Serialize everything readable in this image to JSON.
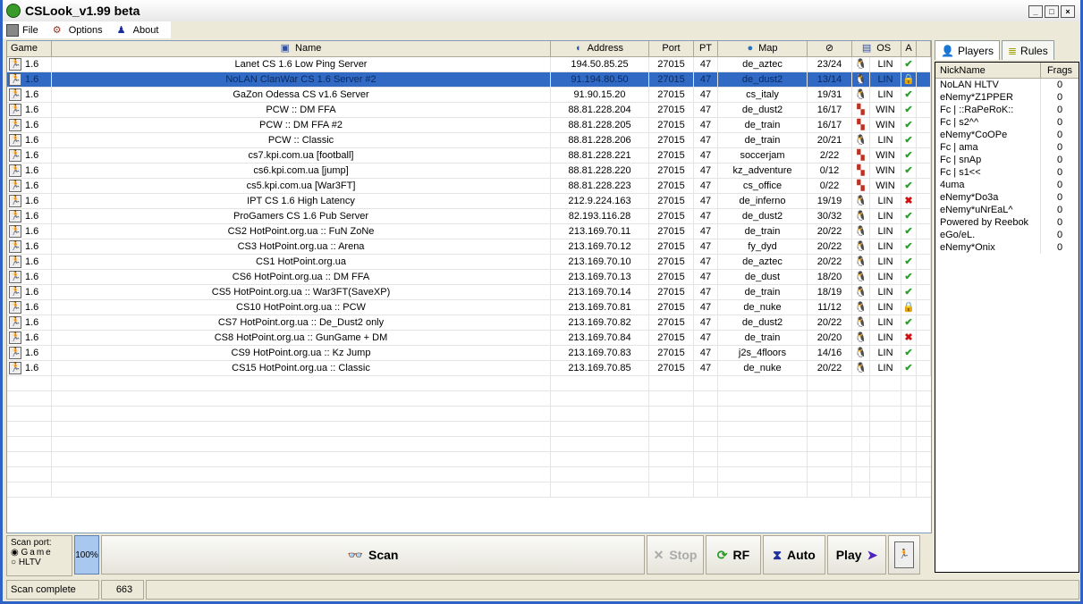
{
  "window": {
    "title": "CSLook_v1.99 beta"
  },
  "menu": {
    "file": "File",
    "options": "Options",
    "about": "About"
  },
  "columns": {
    "game": "Game",
    "name": "Name",
    "address": "Address",
    "port": "Port",
    "pt": "PT",
    "map": "Map",
    "os": "OS",
    "a": "A"
  },
  "servers": [
    {
      "game": "1.6",
      "name": "Lanet CS 1.6 Low Ping Server",
      "address": "194.50.85.25",
      "port": "27015",
      "pt": "47",
      "map": "de_aztec",
      "players": "23/24",
      "os": "LIN",
      "status": "ok"
    },
    {
      "game": "1.6",
      "name": "NoLAN ClanWar CS 1.6 Server #2",
      "address": "91.194.80.50",
      "port": "27015",
      "pt": "47",
      "map": "de_dust2",
      "players": "13/14",
      "os": "LIN",
      "status": "locked",
      "selected": true
    },
    {
      "game": "1.6",
      "name": "GaZon Odessa CS v1.6 Server",
      "address": "91.90.15.20",
      "port": "27015",
      "pt": "47",
      "map": "cs_italy",
      "players": "19/31",
      "os": "LIN",
      "status": "ok"
    },
    {
      "game": "1.6",
      "name": "PCW :: DM FFA",
      "address": "88.81.228.204",
      "port": "27015",
      "pt": "47",
      "map": "de_dust2",
      "players": "16/17",
      "os": "WIN",
      "status": "ok"
    },
    {
      "game": "1.6",
      "name": "PCW :: DM FFA #2",
      "address": "88.81.228.205",
      "port": "27015",
      "pt": "47",
      "map": "de_train",
      "players": "16/17",
      "os": "WIN",
      "status": "ok"
    },
    {
      "game": "1.6",
      "name": "PCW :: Classic",
      "address": "88.81.228.206",
      "port": "27015",
      "pt": "47",
      "map": "de_train",
      "players": "20/21",
      "os": "LIN",
      "status": "ok"
    },
    {
      "game": "1.6",
      "name": "cs7.kpi.com.ua [football]",
      "address": "88.81.228.221",
      "port": "27015",
      "pt": "47",
      "map": "soccerjam",
      "players": "2/22",
      "os": "WIN",
      "status": "ok"
    },
    {
      "game": "1.6",
      "name": "cs6.kpi.com.ua [jump]",
      "address": "88.81.228.220",
      "port": "27015",
      "pt": "47",
      "map": "kz_adventure",
      "players": "0/12",
      "os": "WIN",
      "status": "ok"
    },
    {
      "game": "1.6",
      "name": "cs5.kpi.com.ua [War3FT]",
      "address": "88.81.228.223",
      "port": "27015",
      "pt": "47",
      "map": "cs_office",
      "players": "0/22",
      "os": "WIN",
      "status": "ok"
    },
    {
      "game": "1.6",
      "name": "IPT CS 1.6 High Latency",
      "address": "212.9.224.163",
      "port": "27015",
      "pt": "47",
      "map": "de_inferno",
      "players": "19/19",
      "os": "LIN",
      "status": "down"
    },
    {
      "game": "1.6",
      "name": "ProGamers CS 1.6 Pub Server",
      "address": "82.193.116.28",
      "port": "27015",
      "pt": "47",
      "map": "de_dust2",
      "players": "30/32",
      "os": "LIN",
      "status": "ok"
    },
    {
      "game": "1.6",
      "name": "CS2 HotPoint.org.ua :: FuN ZoNe",
      "address": "213.169.70.11",
      "port": "27015",
      "pt": "47",
      "map": "de_train",
      "players": "20/22",
      "os": "LIN",
      "status": "ok"
    },
    {
      "game": "1.6",
      "name": "CS3 HotPoint.org.ua :: Arena",
      "address": "213.169.70.12",
      "port": "27015",
      "pt": "47",
      "map": "fy_dyd",
      "players": "20/22",
      "os": "LIN",
      "status": "ok"
    },
    {
      "game": "1.6",
      "name": "CS1 HotPoint.org.ua",
      "address": "213.169.70.10",
      "port": "27015",
      "pt": "47",
      "map": "de_aztec",
      "players": "20/22",
      "os": "LIN",
      "status": "ok"
    },
    {
      "game": "1.6",
      "name": "CS6 HotPoint.org.ua :: DM FFA",
      "address": "213.169.70.13",
      "port": "27015",
      "pt": "47",
      "map": "de_dust",
      "players": "18/20",
      "os": "LIN",
      "status": "ok"
    },
    {
      "game": "1.6",
      "name": "CS5 HotPoint.org.ua :: War3FT(SaveXP)",
      "address": "213.169.70.14",
      "port": "27015",
      "pt": "47",
      "map": "de_train",
      "players": "18/19",
      "os": "LIN",
      "status": "ok"
    },
    {
      "game": "1.6",
      "name": "CS10 HotPoint.org.ua :: PCW",
      "address": "213.169.70.81",
      "port": "27015",
      "pt": "47",
      "map": "de_nuke",
      "players": "11/12",
      "os": "LIN",
      "status": "locked"
    },
    {
      "game": "1.6",
      "name": "CS7 HotPoint.org.ua :: De_Dust2 only",
      "address": "213.169.70.82",
      "port": "27015",
      "pt": "47",
      "map": "de_dust2",
      "players": "20/22",
      "os": "LIN",
      "status": "ok"
    },
    {
      "game": "1.6",
      "name": "CS8 HotPoint.org.ua :: GunGame + DM",
      "address": "213.169.70.84",
      "port": "27015",
      "pt": "47",
      "map": "de_train",
      "players": "20/20",
      "os": "LIN",
      "status": "down"
    },
    {
      "game": "1.6",
      "name": "CS9 HotPoint.org.ua :: Kz Jump",
      "address": "213.169.70.83",
      "port": "27015",
      "pt": "47",
      "map": "j2s_4floors",
      "players": "14/16",
      "os": "LIN",
      "status": "ok"
    },
    {
      "game": "1.6",
      "name": "CS15 HotPoint.org.ua :: Classic",
      "address": "213.169.70.85",
      "port": "27015",
      "pt": "47",
      "map": "de_nuke",
      "players": "20/22",
      "os": "LIN",
      "status": "ok"
    }
  ],
  "side": {
    "tab_players": "Players",
    "tab_rules": "Rules",
    "col_nick": "NickName",
    "col_frags": "Frags",
    "players": [
      {
        "nick": "NoLAN HLTV",
        "frags": "0"
      },
      {
        "nick": "eNemy*Z1PPER",
        "frags": "0"
      },
      {
        "nick": "Fc | ::RaPeRoK::",
        "frags": "0"
      },
      {
        "nick": "Fc | s2^^",
        "frags": "0"
      },
      {
        "nick": "eNemy*CoOPe",
        "frags": "0"
      },
      {
        "nick": "Fc | ama",
        "frags": "0"
      },
      {
        "nick": "Fc | snAp",
        "frags": "0"
      },
      {
        "nick": "Fc | s1<<",
        "frags": "0"
      },
      {
        "nick": "4uma",
        "frags": "0"
      },
      {
        "nick": "eNemy*Do3a",
        "frags": "0"
      },
      {
        "nick": "eNemy*uNrEaL^",
        "frags": "0"
      },
      {
        "nick": "Powered by Reebok",
        "frags": "0"
      },
      {
        "nick": "eGo/eL.",
        "frags": "0"
      },
      {
        "nick": "eNemy*Onix",
        "frags": "0"
      }
    ]
  },
  "bottom": {
    "scan_port": "Scan port:",
    "game": "Game",
    "hltv": "HLTV",
    "progress": "100%",
    "scan": "Scan",
    "stop": "Stop",
    "rf": "RF",
    "auto": "Auto",
    "play": "Play"
  },
  "status": {
    "text": "Scan complete",
    "count": "663"
  }
}
